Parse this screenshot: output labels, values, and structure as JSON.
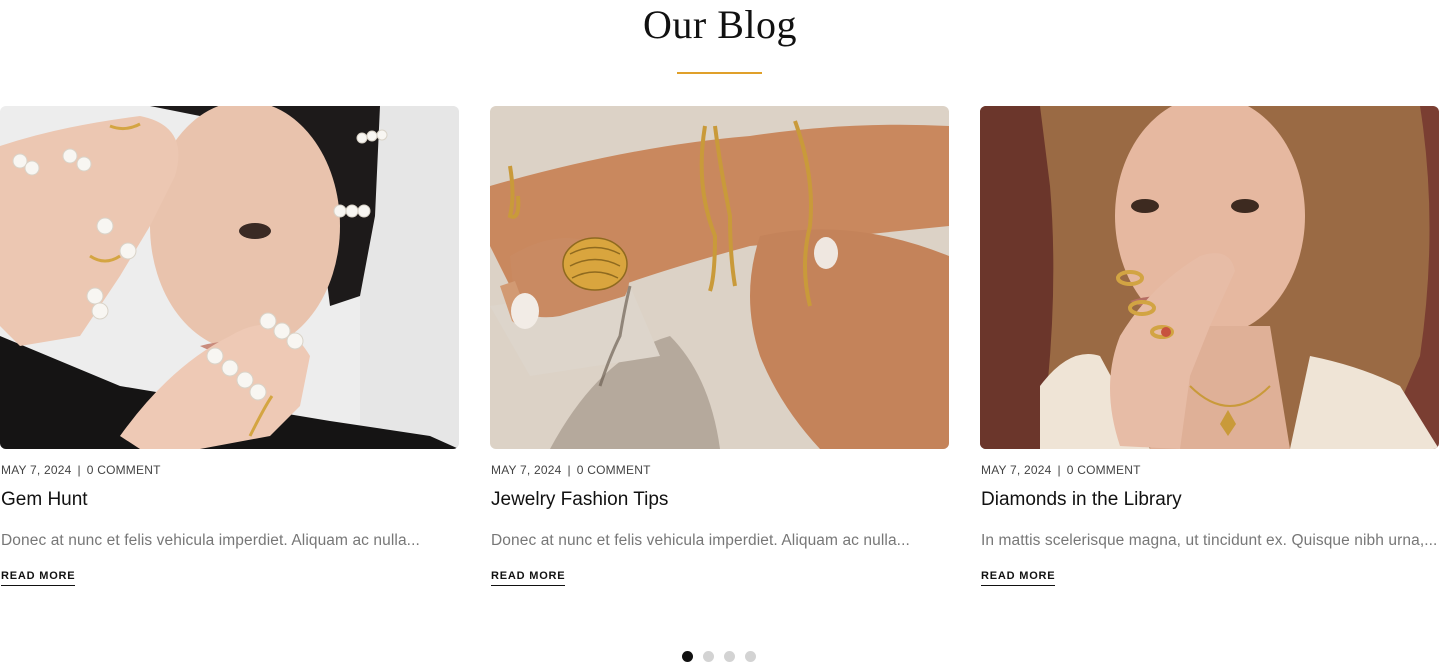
{
  "section": {
    "title": "Our Blog",
    "accent_color": "#e0a02a"
  },
  "posts": [
    {
      "image_alt": "Woman wearing pearl rings covering one eye with her hand",
      "date": "MAY 7, 2024",
      "comments": "0 COMMENT",
      "title": "Gem Hunt",
      "excerpt": "Donec at nunc et felis vehicula imperdiet. Aliquam ac nulla...",
      "read_more": "READ MORE"
    },
    {
      "image_alt": "Hands wearing gold chain bracelets and a chunky gold ring",
      "date": "MAY 7, 2024",
      "comments": "0 COMMENT",
      "title": "Jewelry Fashion Tips",
      "excerpt": "Donec at nunc et felis vehicula imperdiet. Aliquam ac nulla...",
      "read_more": "READ MORE"
    },
    {
      "image_alt": "Woman with long hair wearing gold rings and a pendant necklace",
      "date": "MAY 7, 2024",
      "comments": "0 COMMENT",
      "title": "Diamonds in the Library",
      "excerpt": "In mattis scelerisque magna, ut tincidunt ex. Quisque nibh urna,...",
      "read_more": "READ MORE"
    }
  ],
  "pagination": {
    "pages": 4,
    "active": 1
  }
}
